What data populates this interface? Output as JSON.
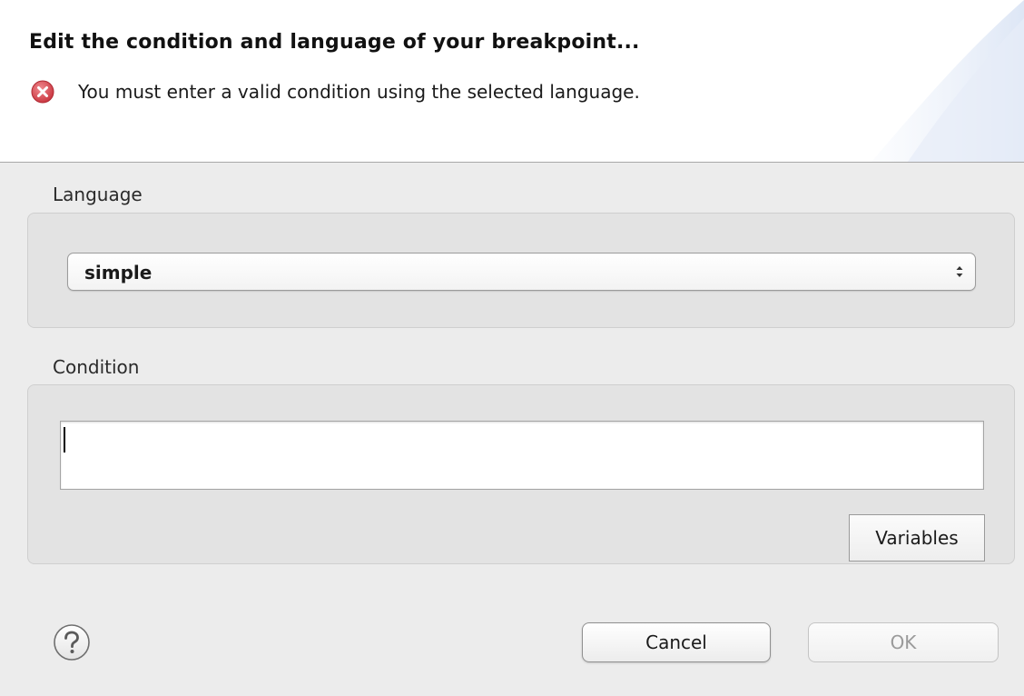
{
  "header": {
    "title": "Edit the condition and language of your breakpoint...",
    "message": "You must enter a valid condition using the selected language.",
    "message_icon": "error-icon"
  },
  "language_group": {
    "label": "Language",
    "selected_value": "simple"
  },
  "condition_group": {
    "label": "Condition",
    "value": "",
    "variables_label": "Variables"
  },
  "footer": {
    "help_icon": "help-icon",
    "cancel_label": "Cancel",
    "ok_label": "OK",
    "ok_enabled": false
  },
  "colors": {
    "error_red": "#d9404a",
    "dialog_bg": "#ececec",
    "group_bg": "#e3e3e3",
    "header_bg": "#ffffff",
    "disabled_text": "#9a9a9a"
  }
}
